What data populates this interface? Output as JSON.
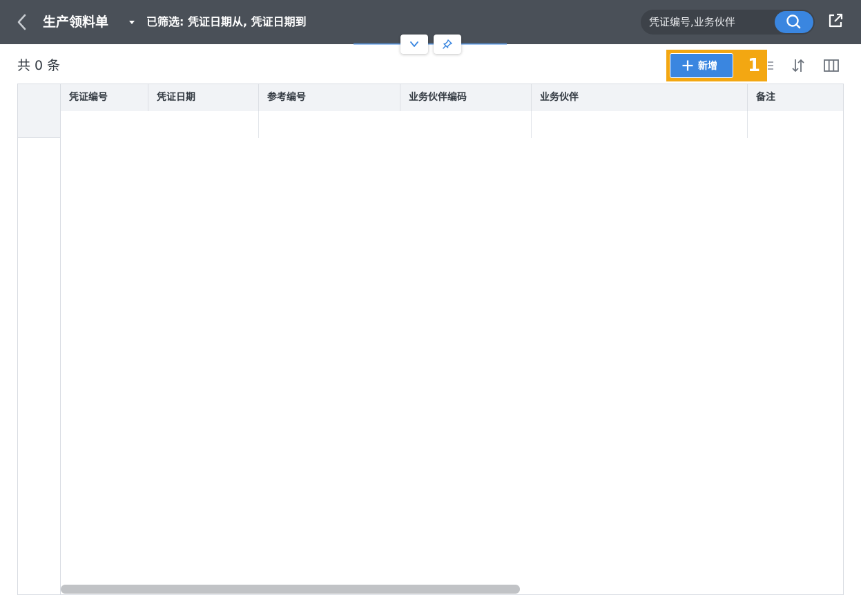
{
  "header": {
    "title": "生产领料单",
    "filter_text": "已筛选: 凭证日期从, 凭证日期到",
    "search_placeholder": "凭证编号,业务伙伴"
  },
  "toolbar": {
    "record_count": "共 0 条",
    "add_label": "新增",
    "step_badge": "1"
  },
  "table": {
    "columns": [
      "凭证编号",
      "凭证日期",
      "参考编号",
      "业务伙伴编码",
      "业务伙伴",
      "备注"
    ],
    "rows": []
  },
  "colors": {
    "header_bg": "#4a5058",
    "accent_blue": "#3a86e0",
    "highlight_orange": "#f3a712",
    "table_header_bg": "#f1f3f6"
  },
  "icons": {
    "back": "chevron-left-icon",
    "caret": "caret-down-icon",
    "search": "search-icon",
    "export": "export-icon",
    "collapse": "chevron-down-icon",
    "pin": "pin-icon",
    "add": "plus-icon",
    "sort": "sort-icon",
    "columns": "columns-icon"
  }
}
